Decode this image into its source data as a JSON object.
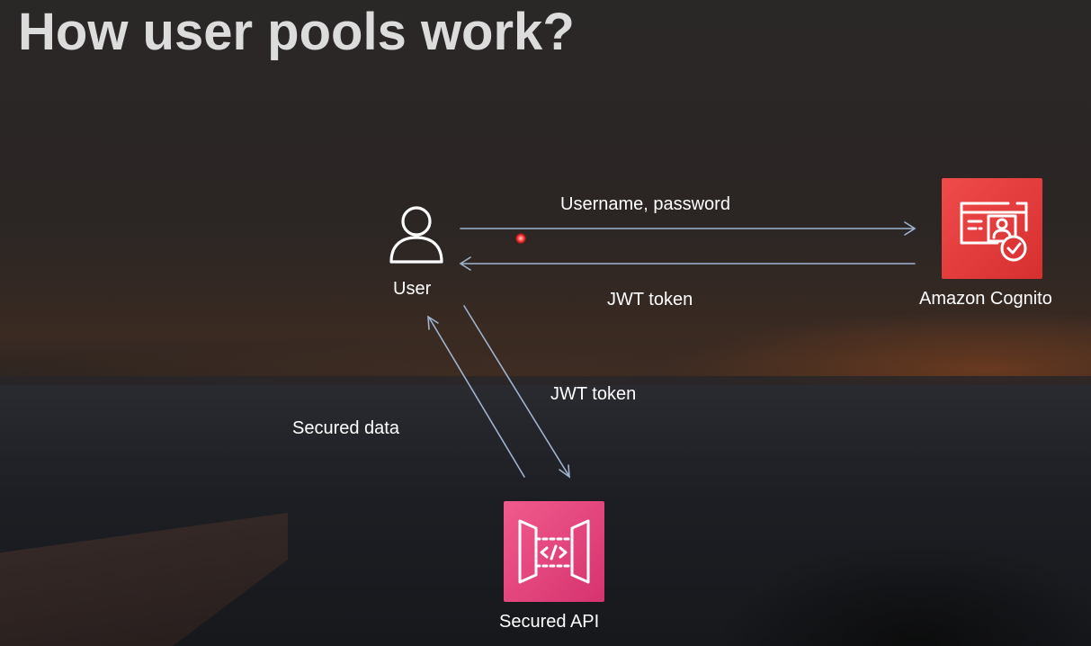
{
  "slide": {
    "title": "How user pools work?"
  },
  "nodes": {
    "user": {
      "label": "User",
      "icon": "user-icon"
    },
    "cognito": {
      "label": "Amazon Cognito",
      "icon": "cognito-identity-icon",
      "color": "#e53b3b"
    },
    "api": {
      "label": "Secured API",
      "icon": "api-gateway-icon",
      "color": "#e2477d"
    }
  },
  "edges": {
    "credentials": "Username, password",
    "token_from_cognito": "JWT token",
    "token_to_api": "JWT token",
    "secured_data": "Secured data"
  },
  "colors": {
    "arrow": "#9fb3cf",
    "text": "#ffffff",
    "title": "#dcdcdc"
  }
}
